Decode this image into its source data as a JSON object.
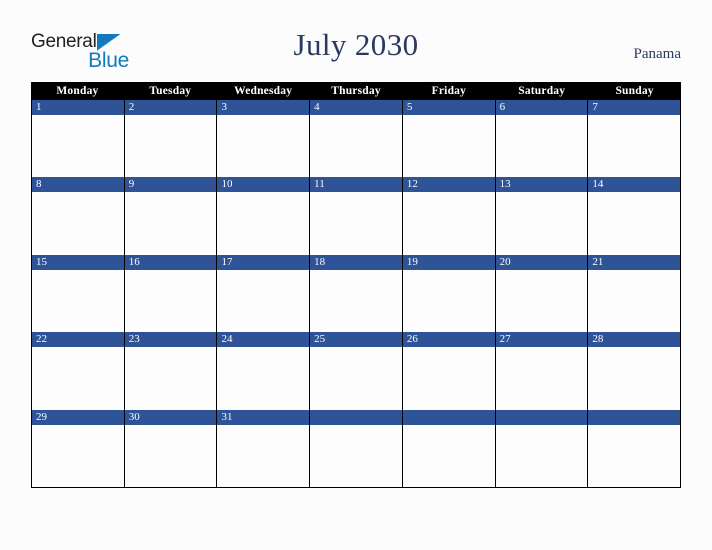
{
  "brand": {
    "logo_text_primary": "General",
    "logo_text_secondary": "Blue",
    "logo_triangle_icon": "triangle-icon",
    "primary_color": "#1279be",
    "text_color": "#231f20"
  },
  "header": {
    "title": "July 2030",
    "month": "July",
    "year": "2030",
    "location": "Panama",
    "title_color": "#2a3a5c"
  },
  "calendar": {
    "accent_color": "#2e5396",
    "header_bg_color": "#000000",
    "header_text_color": "#ffffff",
    "weekdays": [
      "Monday",
      "Tuesday",
      "Wednesday",
      "Thursday",
      "Friday",
      "Saturday",
      "Sunday"
    ],
    "weeks": [
      [
        {
          "day": "1"
        },
        {
          "day": "2"
        },
        {
          "day": "3"
        },
        {
          "day": "4"
        },
        {
          "day": "5"
        },
        {
          "day": "6"
        },
        {
          "day": "7"
        }
      ],
      [
        {
          "day": "8"
        },
        {
          "day": "9"
        },
        {
          "day": "10"
        },
        {
          "day": "11"
        },
        {
          "day": "12"
        },
        {
          "day": "13"
        },
        {
          "day": "14"
        }
      ],
      [
        {
          "day": "15"
        },
        {
          "day": "16"
        },
        {
          "day": "17"
        },
        {
          "day": "18"
        },
        {
          "day": "19"
        },
        {
          "day": "20"
        },
        {
          "day": "21"
        }
      ],
      [
        {
          "day": "22"
        },
        {
          "day": "23"
        },
        {
          "day": "24"
        },
        {
          "day": "25"
        },
        {
          "day": "26"
        },
        {
          "day": "27"
        },
        {
          "day": "28"
        }
      ],
      [
        {
          "day": "29"
        },
        {
          "day": "30"
        },
        {
          "day": "31"
        },
        {
          "day": ""
        },
        {
          "day": ""
        },
        {
          "day": ""
        },
        {
          "day": ""
        }
      ]
    ]
  }
}
